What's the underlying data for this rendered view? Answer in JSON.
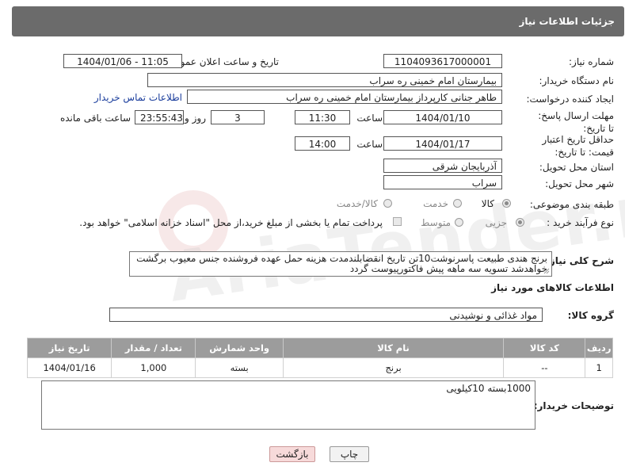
{
  "header": {
    "title": "جزئیات اطلاعات نیاز"
  },
  "fields": {
    "need_number_label": "شماره نیاز:",
    "need_number": "1104093617000001",
    "announce_label": "تاریخ و ساعت اعلان عمومی:",
    "announce_value": "1404/01/06 - 11:05",
    "buyer_org_label": "نام دستگاه خریدار:",
    "buyer_org": "بیمارستان امام خمینی ره  سراب",
    "requester_label": "ایجاد کننده درخواست:",
    "requester": "طاهر جنانی کارپرداز بیمارستان امام خمینی ره  سراب",
    "contact_link": "اطلاعات تماس خریدار",
    "deadline_label": "مهلت ارسال پاسخ: تا تاریخ:",
    "deadline_date": "1404/01/10",
    "time_label": "ساعت",
    "deadline_time": "11:30",
    "days_value": "3",
    "days_label": "روز و",
    "remaining_time": "23:55:43",
    "remaining_label": "ساعت باقی مانده",
    "validity_label": "حداقل تاریخ اعتبار قیمت: تا تاریخ:",
    "validity_date": "1404/01/17",
    "validity_time": "14:00",
    "province_label": "استان محل تحویل:",
    "province": "آذربایجان شرقی",
    "city_label": "شهر محل تحویل:",
    "city": "سراب",
    "category_label": "طبقه بندی موضوعی:",
    "category_options": [
      "کالا",
      "خدمت",
      "کالا/خدمت"
    ],
    "category_selected": "کالا",
    "process_label": "نوع فرآیند خرید :",
    "process_options": [
      "جزیی",
      "متوسط"
    ],
    "process_selected": "جزیی",
    "payment_note": "پرداخت تمام یا بخشی از مبلغ خرید،از محل \"اسناد خزانه اسلامی\" خواهد بود."
  },
  "description": {
    "label": "شرح کلی نیاز:",
    "text": "برنج هندی طبیعت پاسرنوشت10تن تاریخ انقضابلندمدت هزینه حمل عهده فروشنده جنس معیوب برگشت خواهدشد تسویه سه ماهه پیش فاکتورپیوست گردد"
  },
  "goods_section": {
    "title": "اطلاعات کالاهای مورد نیاز",
    "group_label": "گروه کالا:",
    "group_value": "مواد غذائی و نوشیدنی"
  },
  "table": {
    "headers": [
      "ردیف",
      "کد کالا",
      "نام کالا",
      "واحد شمارش",
      "تعداد / مقدار",
      "تاریخ نیاز"
    ],
    "rows": [
      [
        "1",
        "--",
        "برنج",
        "بسته",
        "1,000",
        "1404/01/16"
      ]
    ]
  },
  "buyer_notes": {
    "label": "توضیحات خریدار:",
    "text": "1000بسته 10کیلویی"
  },
  "buttons": {
    "print": "چاپ",
    "back": "بازگشت"
  },
  "watermark": {
    "text": "AriaTender.net"
  }
}
